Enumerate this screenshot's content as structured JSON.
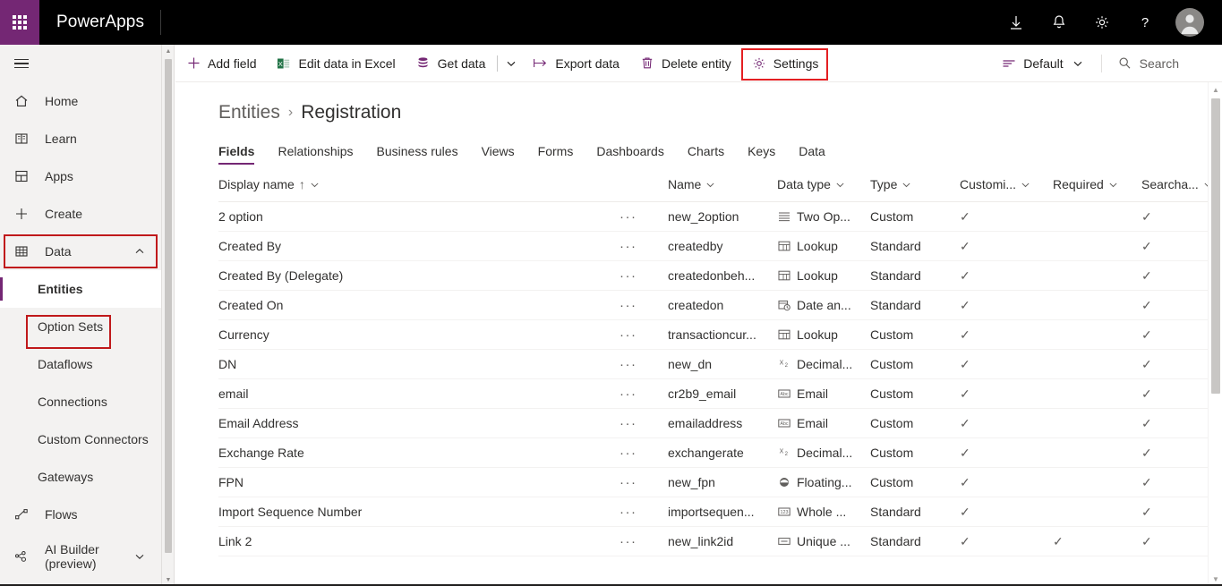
{
  "header": {
    "waffle_icon": "app-launcher-icon",
    "brand": "PowerApps",
    "icons": [
      {
        "name": "download-icon",
        "glyph": "download"
      },
      {
        "name": "notifications-bell-icon",
        "glyph": "bell"
      },
      {
        "name": "settings-gear-icon",
        "glyph": "gear"
      },
      {
        "name": "help-icon",
        "glyph": "question"
      }
    ],
    "avatar": "user-avatar"
  },
  "sidebar": {
    "hamburger": "menu-icon",
    "items": [
      {
        "label": "Home",
        "icon": "home-icon",
        "type": "item"
      },
      {
        "label": "Learn",
        "icon": "book-icon",
        "type": "item"
      },
      {
        "label": "Apps",
        "icon": "apps-grid-icon",
        "type": "item"
      },
      {
        "label": "Create",
        "icon": "plus-icon",
        "type": "item"
      },
      {
        "label": "Data",
        "icon": "table-icon",
        "type": "item",
        "expanded": true,
        "chevron": "chevron-up-icon",
        "highlighted": true
      },
      {
        "label": "Entities",
        "type": "sub",
        "selected": true,
        "highlighted": true
      },
      {
        "label": "Option Sets",
        "type": "sub"
      },
      {
        "label": "Dataflows",
        "type": "sub"
      },
      {
        "label": "Connections",
        "type": "sub"
      },
      {
        "label": "Custom Connectors",
        "type": "sub"
      },
      {
        "label": "Gateways",
        "type": "sub"
      },
      {
        "label": "Flows",
        "icon": "flow-icon",
        "type": "item"
      },
      {
        "label": "AI Builder (preview)",
        "label_line1": "AI Builder",
        "label_line2": "(preview)",
        "icon": "ai-builder-icon",
        "type": "item",
        "chevron": "chevron-down-icon"
      }
    ]
  },
  "commandbar": {
    "add_field": "Add field",
    "edit_in_excel": "Edit data in Excel",
    "get_data": "Get data",
    "export_data": "Export data",
    "delete_entity": "Delete entity",
    "settings": "Settings",
    "view_selector": "Default",
    "search": "Search",
    "settings_highlighted": true
  },
  "breadcrumb": {
    "parent": "Entities",
    "separator": "›",
    "current": "Registration"
  },
  "tabs": [
    {
      "label": "Fields",
      "active": true
    },
    {
      "label": "Relationships",
      "active": false
    },
    {
      "label": "Business rules",
      "active": false
    },
    {
      "label": "Views",
      "active": false
    },
    {
      "label": "Forms",
      "active": false
    },
    {
      "label": "Dashboards",
      "active": false
    },
    {
      "label": "Charts",
      "active": false
    },
    {
      "label": "Keys",
      "active": false
    },
    {
      "label": "Data",
      "active": false
    }
  ],
  "table": {
    "columns": [
      {
        "label": "Display name",
        "sort": "↑",
        "chevron": true
      },
      {
        "label": "",
        "chevron": false
      },
      {
        "label": "Name",
        "chevron": true
      },
      {
        "label": "Data type",
        "chevron": true
      },
      {
        "label": "Type",
        "chevron": true
      },
      {
        "label": "Customi...",
        "chevron": true
      },
      {
        "label": "Required",
        "chevron": true
      },
      {
        "label": "Searcha...",
        "chevron": true
      }
    ],
    "ellipsis": "···",
    "check": "✓",
    "rows": [
      {
        "display_name": "2 option",
        "name": "new_2option",
        "data_type": "Two Op...",
        "data_type_icon": "two-options-icon",
        "type": "Custom",
        "customizable": true,
        "required": false,
        "searchable": true
      },
      {
        "display_name": "Created By",
        "name": "createdby",
        "data_type": "Lookup",
        "data_type_icon": "lookup-icon",
        "type": "Standard",
        "customizable": true,
        "required": false,
        "searchable": true
      },
      {
        "display_name": "Created By (Delegate)",
        "name": "createdonbeh...",
        "data_type": "Lookup",
        "data_type_icon": "lookup-icon",
        "type": "Standard",
        "customizable": true,
        "required": false,
        "searchable": true
      },
      {
        "display_name": "Created On",
        "name": "createdon",
        "data_type": "Date an...",
        "data_type_icon": "date-time-icon",
        "type": "Standard",
        "customizable": true,
        "required": false,
        "searchable": true
      },
      {
        "display_name": "Currency",
        "name": "transactioncur...",
        "data_type": "Lookup",
        "data_type_icon": "lookup-icon",
        "type": "Custom",
        "customizable": true,
        "required": false,
        "searchable": true
      },
      {
        "display_name": "DN",
        "name": "new_dn",
        "data_type": "Decimal...",
        "data_type_icon": "decimal-icon",
        "type": "Custom",
        "customizable": true,
        "required": false,
        "searchable": true
      },
      {
        "display_name": "email",
        "name": "cr2b9_email",
        "data_type": "Email",
        "data_type_icon": "email-text-icon",
        "type": "Custom",
        "customizable": true,
        "required": false,
        "searchable": true
      },
      {
        "display_name": "Email Address",
        "name": "emailaddress",
        "data_type": "Email",
        "data_type_icon": "email-text-icon",
        "type": "Custom",
        "customizable": true,
        "required": false,
        "searchable": true
      },
      {
        "display_name": "Exchange Rate",
        "name": "exchangerate",
        "data_type": "Decimal...",
        "data_type_icon": "decimal-icon",
        "type": "Custom",
        "customizable": true,
        "required": false,
        "searchable": true
      },
      {
        "display_name": "FPN",
        "name": "new_fpn",
        "data_type": "Floating...",
        "data_type_icon": "floating-point-icon",
        "type": "Custom",
        "customizable": true,
        "required": false,
        "searchable": true
      },
      {
        "display_name": "Import Sequence Number",
        "name": "importsequen...",
        "data_type": "Whole ...",
        "data_type_icon": "whole-number-icon",
        "type": "Standard",
        "customizable": true,
        "required": false,
        "searchable": true
      },
      {
        "display_name": "Link 2",
        "name": "new_link2id",
        "data_type": "Unique ...",
        "data_type_icon": "unique-id-icon",
        "type": "Standard",
        "customizable": true,
        "required": true,
        "searchable": true
      }
    ]
  },
  "colors": {
    "brand_purple": "#742774",
    "header_black": "#000000",
    "highlight_red": "#c0191b",
    "sidebar_bg": "#f3f2f1"
  }
}
